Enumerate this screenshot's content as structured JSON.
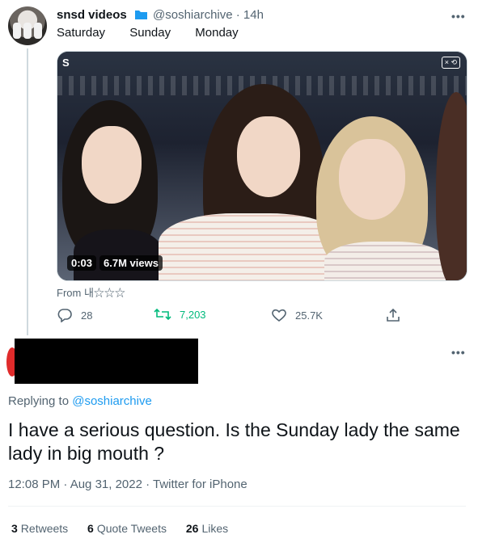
{
  "quoted_tweet": {
    "author_name": "snsd videos",
    "handle_time": "@soshiarchive · 14h",
    "text_items": [
      "Saturday",
      "Sunday",
      "Monday"
    ],
    "more_label": "•••",
    "media": {
      "logo_left": "S",
      "logo_right": "× ⟲",
      "time_label": "0:03",
      "views_label": "6.7M views"
    },
    "from_label": "From 내☆☆☆",
    "actions": {
      "replies": "28",
      "retweets": "7,203",
      "likes": "25.7K"
    },
    "colors": {
      "retweet": "#00ba7c",
      "link": "#1d9bf0"
    }
  },
  "reply": {
    "more_label": "•••",
    "replying_prefix": "Replying to",
    "replying_handle": "@soshiarchive",
    "text": "I have a serious question. Is the Sunday lady the same lady in big mouth ?",
    "meta": "12:08 PM · Aug 31, 2022 · Twitter for iPhone",
    "stats": {
      "retweets_count": "3",
      "retweets_label": "Retweets",
      "quotes_count": "6",
      "quotes_label": "Quote Tweets",
      "likes_count": "26",
      "likes_label": "Likes"
    }
  }
}
